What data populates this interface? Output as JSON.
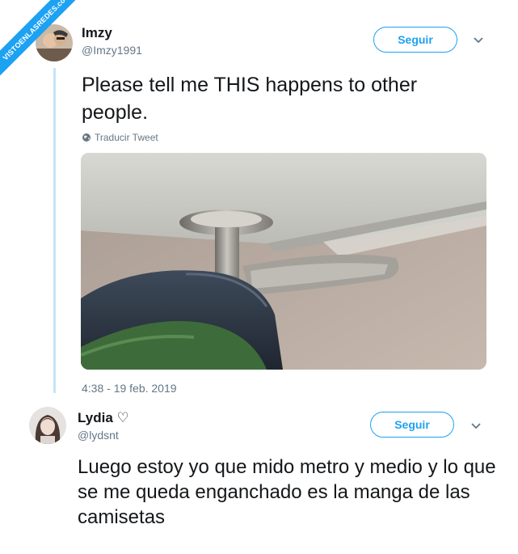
{
  "watermark": "VISTOENLASREDES.com",
  "tweet1": {
    "display_name": "Imzy",
    "handle": "@Imzy1991",
    "follow_label": "Seguir",
    "text": "Please tell me THIS happens to other people.",
    "translate_label": "Traducir Tweet",
    "timestamp": "4:38 - 19 feb. 2019",
    "photo_icon": "photo-door-knob-sleeve"
  },
  "tweet2": {
    "display_name": "Lydia ♡",
    "handle": "@lydsnt",
    "follow_label": "Seguir",
    "text": "Luego estoy yo que mido metro y medio y lo que se me queda enganchado es la manga de las camisetas"
  },
  "colors": {
    "accent": "#1da1f2",
    "thread_line": "#c4e5f9",
    "secondary_text": "#657786",
    "primary_text": "#14171a"
  }
}
